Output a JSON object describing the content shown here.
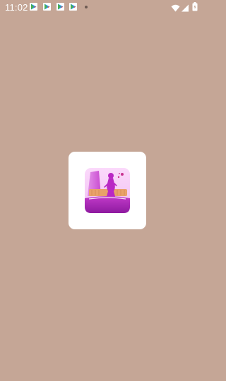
{
  "status_bar": {
    "time": "11:02",
    "notification_icons": [
      "play-store-icon",
      "play-store-icon",
      "play-store-icon",
      "play-store-icon"
    ],
    "system_icons": [
      "wifi-icon",
      "signal-icon",
      "battery-icon"
    ]
  },
  "splash": {
    "logo_icon": "woman-silhouette-app-logo-icon",
    "background_color": "#c5a696",
    "card_color": "#ffffff",
    "logo_primary_color": "#b62fc0"
  }
}
